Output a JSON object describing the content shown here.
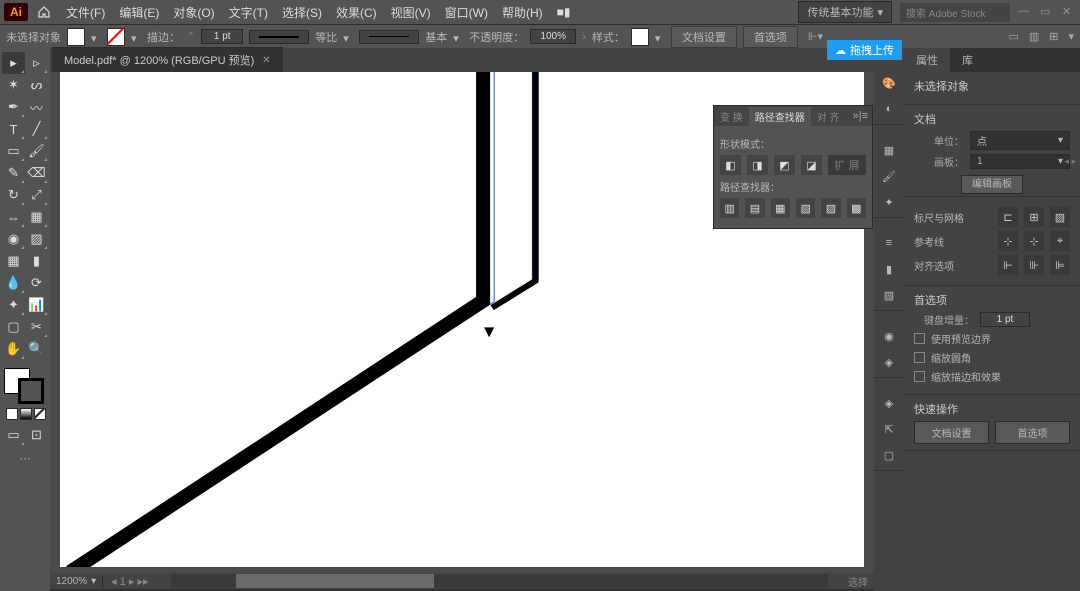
{
  "app": {
    "logo": "Ai"
  },
  "menu": {
    "file": "文件(F)",
    "edit": "编辑(E)",
    "object": "对象(O)",
    "type": "文字(T)",
    "select": "选择(S)",
    "effect": "效果(C)",
    "view": "视图(V)",
    "window": "窗口(W)",
    "help": "帮助(H)",
    "arrange": "■▮"
  },
  "workspace": {
    "name": "传统基本功能",
    "search_ph": "搜索 Adobe Stock"
  },
  "options": {
    "no_sel": "未选择对象",
    "stroke_lbl": "描边：",
    "stroke_val": "1 pt",
    "cap1": "等比",
    "cap2": "基本",
    "opacity_lbl": "不透明度：",
    "opacity_val": "100%",
    "style_lbl": "样式：",
    "doc_setup": "文档设置",
    "prefs": "首选项"
  },
  "doc": {
    "tab": "Model.pdf* @ 1200% (RGB/GPU 预览)",
    "zoom": "1200%",
    "status": "选择"
  },
  "upload": {
    "label": "拖拽上传"
  },
  "props": {
    "tab_prop": "属性",
    "tab_lib": "库",
    "no_sel": "未选择对象",
    "doc": "文档",
    "unit_lbl": "单位：",
    "unit_val": "点",
    "artboard_lbl": "画板：",
    "artboard_val": "1",
    "edit_ab": "编辑画板",
    "rulers": "标尺与网格",
    "guides": "参考线",
    "align": "对齐选项",
    "prefs": "首选项",
    "kbd_lbl": "键盘增量：",
    "kbd_val": "1 pt",
    "c1": "使用预览边界",
    "c2": "缩放圆角",
    "c3": "缩放描边和效果",
    "quick": "快速操作",
    "q1": "文档设置",
    "q2": "首选项"
  },
  "pathfinder": {
    "t1": "变 换",
    "t2": "路径查找器",
    "t3": "对 齐",
    "shape_mode": "形状模式：",
    "pf": "路径查找器：",
    "expand": "扩 展"
  }
}
